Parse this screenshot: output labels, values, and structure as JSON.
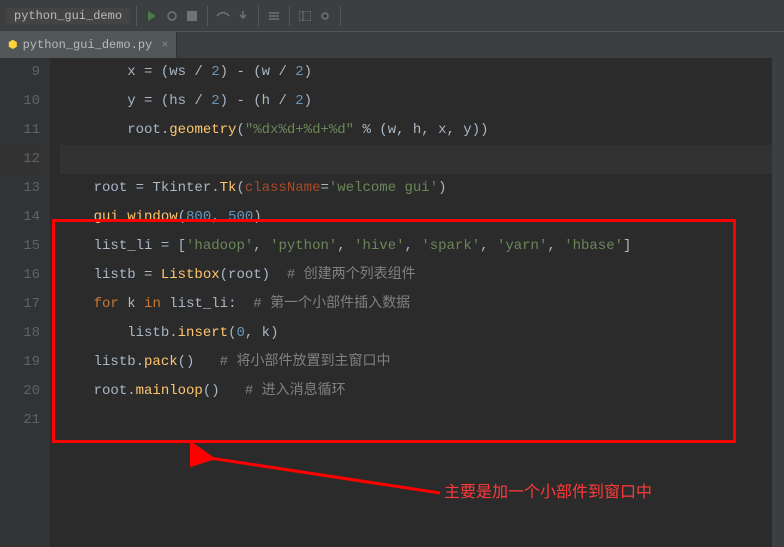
{
  "toolbar": {
    "breadcrumb": "python_gui_demo",
    "icons": [
      "run",
      "debug",
      "stop",
      "step",
      "config",
      "settings",
      "search",
      "layout"
    ]
  },
  "tab": {
    "filename": "python_gui_demo.py",
    "icon": "python-file-icon"
  },
  "gutter": {
    "lines": [
      "9",
      "10",
      "11",
      "12",
      "13",
      "14",
      "15",
      "16",
      "17",
      "18",
      "19",
      "20",
      "21"
    ]
  },
  "code": {
    "l9": {
      "indent": "        ",
      "v": "x = (ws / ",
      "n1": "2",
      "mid": ") - (w / ",
      "n2": "2",
      "end": ")"
    },
    "l10": {
      "indent": "        ",
      "v": "y = (hs / ",
      "n1": "2",
      "mid": ") - (h / ",
      "n2": "2",
      "end": ")"
    },
    "l11": {
      "indent": "        ",
      "pre": "root.",
      "fn": "geometry",
      "open": "(",
      "str": "\"%dx%d+%d+%d\"",
      "op": " % ",
      "args": "(w, h, x, y)",
      "close": ")"
    },
    "l12": "",
    "l13": {
      "indent": "    ",
      "pre": "root = Tkinter.",
      "fn": "Tk",
      "open": "(",
      "param": "className",
      "eq": "=",
      "str": "'welcome gui'",
      "close": ")"
    },
    "l14": {
      "indent": "    ",
      "fn": "gui_window",
      "open": "(",
      "n1": "800",
      "c": ", ",
      "n2": "500",
      "close": ")"
    },
    "l15": {
      "indent": "    ",
      "v": "list_li = [",
      "s1": "'hadoop'",
      "c1": ", ",
      "s2": "'python'",
      "c2": ", ",
      "s3": "'hive'",
      "c3": ", ",
      "s4": "'spark'",
      "c4": ", ",
      "s5": "'yarn'",
      "c5": ", ",
      "s6": "'hbase'",
      "end": "]"
    },
    "l16": {
      "indent": "    ",
      "pre": "listb = ",
      "fn": "Listbox",
      "args": "(root)",
      "comment": "  # 创建两个列表组件"
    },
    "l17": {
      "indent": "    ",
      "kw1": "for",
      "mid1": " k ",
      "kw2": "in",
      "mid2": " list_li:",
      "comment": "  # 第一个小部件插入数据"
    },
    "l18": {
      "indent": "        ",
      "pre": "listb.",
      "fn": "insert",
      "open": "(",
      "n": "0",
      "args": ", k)",
      "close": ""
    },
    "l19": {
      "indent": "    ",
      "pre": "listb.",
      "fn": "pack",
      "args": "()",
      "comment": "   # 将小部件放置到主窗口中"
    },
    "l20": {
      "indent": "    ",
      "pre": "root.",
      "fn": "mainloop",
      "args": "()",
      "comment": "   # 进入消息循环"
    },
    "l21": ""
  },
  "annotation": {
    "text": "主要是加一个小部件到窗口中"
  }
}
